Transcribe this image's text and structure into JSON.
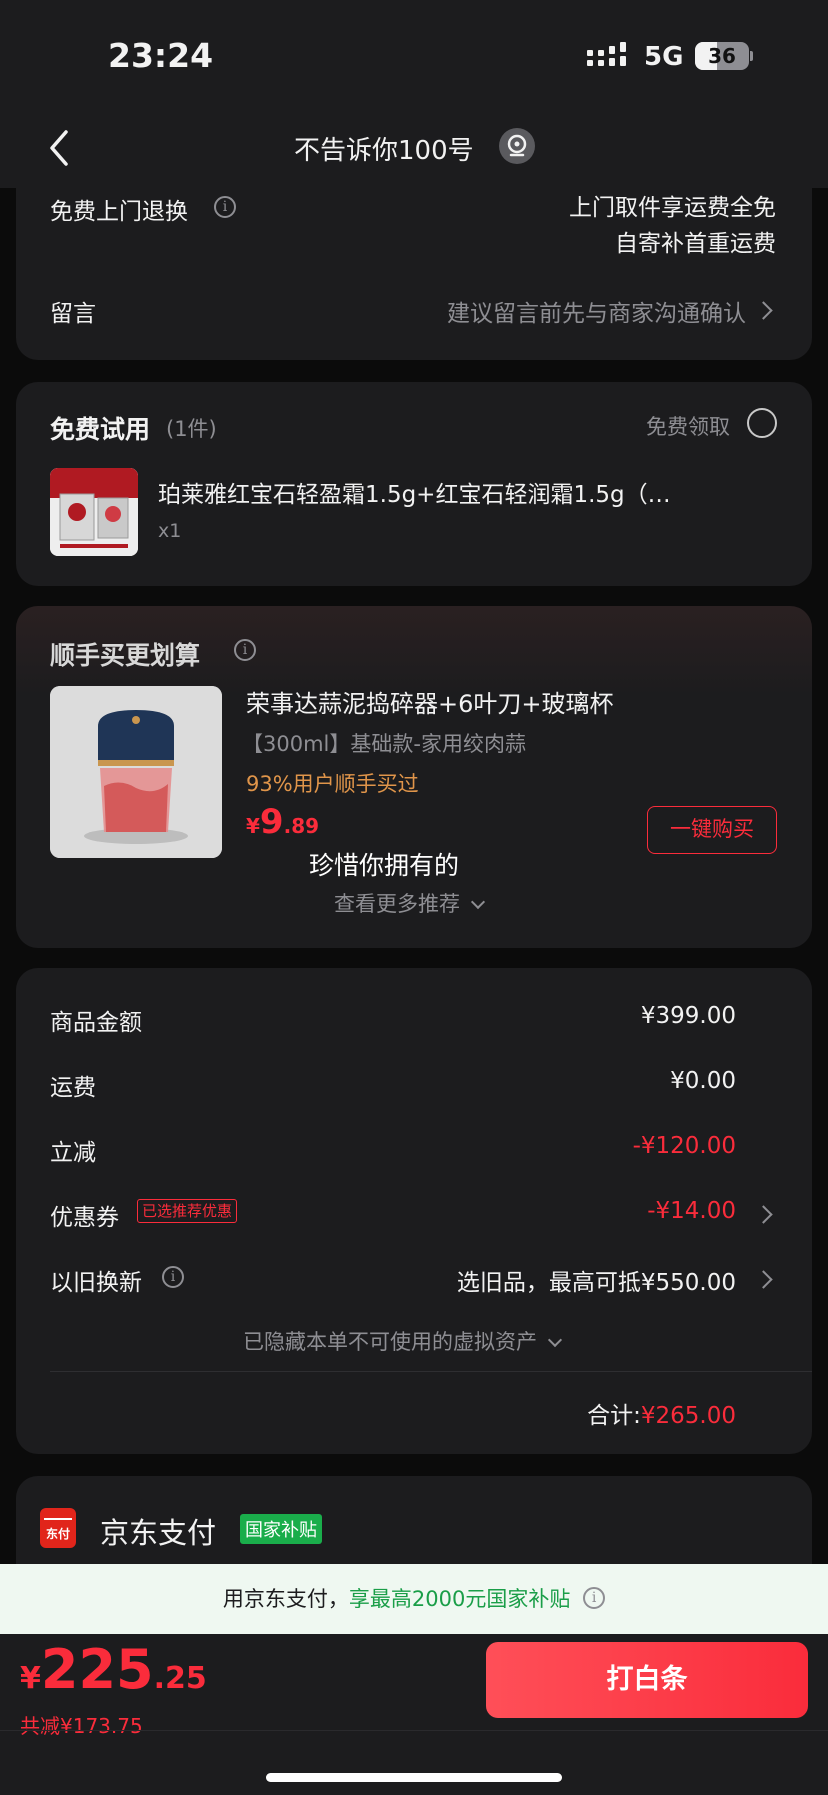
{
  "status_bar": {
    "time": "23:24",
    "network": "5G",
    "battery": "36"
  },
  "nav": {
    "title": "不告诉你100号"
  },
  "returns_section": {
    "label": "免费上门退换",
    "value_line1": "上门取件享运费全免",
    "value_line2": "自寄补首重运费",
    "message_label": "留言",
    "message_placeholder": "建议留言前先与商家沟通确认"
  },
  "free_trial": {
    "title": "免费试用",
    "count": "(1件)",
    "claim_label": "免费领取",
    "item_name": "珀莱雅红宝石轻盈霜1.5g+红宝石轻润霜1.5g（…",
    "item_qty": "x1"
  },
  "addon": {
    "title": "顺手买更划算",
    "product_name": "荣事达蒜泥捣碎器+6叶刀+玻璃杯",
    "product_spec": "【300ml】基础款-家用绞肉蒜",
    "product_stat": "93%用户顺手买过",
    "price_symbol": "¥",
    "price_int": "9",
    "price_dec": ".89",
    "buy_button": "一键购买",
    "overlay_text": "珍惜你拥有的",
    "more": "查看更多推荐"
  },
  "summary": {
    "rows": [
      {
        "label": "商品金额",
        "value": "¥399.00"
      },
      {
        "label": "运费",
        "value": "¥0.00"
      },
      {
        "label": "立减",
        "value": "-¥120.00"
      },
      {
        "label": "优惠券",
        "badge": "已选推荐优惠",
        "value": "-¥14.00"
      },
      {
        "label": "以旧换新",
        "value": "选旧品，最高可抵¥550.00"
      }
    ],
    "hidden_note": "已隐藏本单不可使用的虚拟资产",
    "total_label": "合计:",
    "total_value": "¥265.00"
  },
  "payment": {
    "icon_text": "东付",
    "name": "京东支付",
    "badge": "国家补贴"
  },
  "banner": {
    "text_prefix": "用京东支付，",
    "text_highlight": "享最高2000元国家补贴"
  },
  "bottom": {
    "price_symbol": "¥",
    "price_int": "225",
    "price_dec": ".25",
    "saved": "共减¥173.75",
    "pay_button": "打白条"
  },
  "colors": {
    "accent_red": "#fa2c3b",
    "green": "#1aad4b",
    "card": "#1c1c1e",
    "addon_price_orange": "#e0954a"
  }
}
